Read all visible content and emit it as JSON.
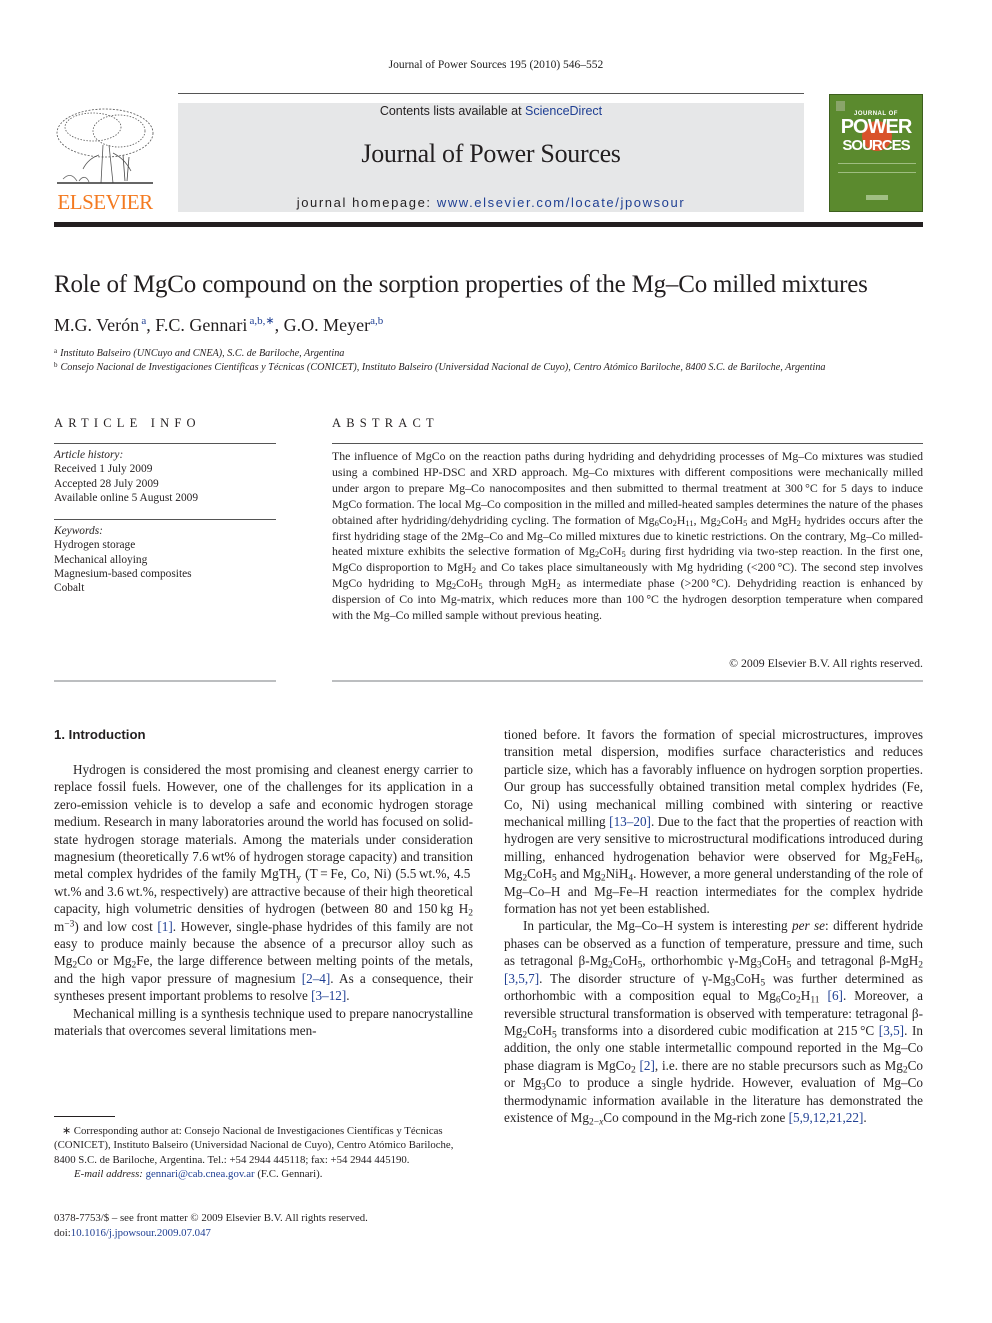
{
  "running_head": "Journal of Power Sources 195 (2010) 546–552",
  "banner": {
    "contents_prefix": "Contents lists available at ",
    "contents_link": "ScienceDirect",
    "journal_title": "Journal of Power Sources",
    "homepage_prefix": "journal homepage: ",
    "homepage_link": "www.elsevier.com/locate/jpowsour"
  },
  "publisher_logo": {
    "word": "ELSEVIER",
    "color": "#f47a20"
  },
  "cover": {
    "top_text": "JOURNAL OF",
    "line1": "POWER",
    "line2": "SOURCES",
    "color": "#5b8a2e"
  },
  "article": {
    "title": "Role of MgCo compound on the sorption properties of the Mg–Co milled mixtures",
    "authors": [
      {
        "name": "M.G. Verón",
        "marks": "a",
        "sep": ", "
      },
      {
        "name": "F.C. Gennari",
        "marks": "a,b,∗",
        "sep": ", "
      },
      {
        "name": "G.O. Meyer",
        "marks": "a,b",
        "sep": ""
      }
    ],
    "affiliations": [
      {
        "mark": "a",
        "text": "Instituto Balseiro (UNCuyo and CNEA), S.C. de Bariloche, Argentina"
      },
      {
        "mark": "b",
        "text": "Consejo Nacional de Investigaciones Científicas y Técnicas (CONICET), Instituto Balseiro (Universidad Nacional de Cuyo), Centro Atómico Bariloche, 8400 S.C. de Bariloche, Argentina"
      }
    ]
  },
  "article_info": {
    "heading": "ARTICLE INFO",
    "history_label": "Article history:",
    "history": [
      "Received 1 July 2009",
      "Accepted 28 July 2009",
      "Available online 5 August 2009"
    ],
    "keywords_label": "Keywords:",
    "keywords": [
      "Hydrogen storage",
      "Mechanical alloying",
      "Magnesium-based composites",
      "Cobalt"
    ]
  },
  "abstract": {
    "heading": "ABSTRACT",
    "copyright": "© 2009 Elsevier B.V. All rights reserved."
  },
  "intro": {
    "heading": "1.  Introduction"
  },
  "footnote": {
    "corresponding": "∗  Corresponding author at: Consejo Nacional de Investigaciones Científicas y Técnicas (CONICET), Instituto Balseiro (Universidad Nacional de Cuyo), Centro Atómico Bariloche, 8400 S.C. de Bariloche, Argentina. Tel.: +54 2944 445118; fax: +54 2944 445190.",
    "email_label": "E-mail address:",
    "email": "gennari@cab.cnea.gov.ar",
    "email_suffix": " (F.C. Gennari)."
  },
  "front_matter": {
    "issn_line": "0378-7753/$ – see front matter © 2009 Elsevier B.V. All rights reserved.",
    "doi_prefix": "doi:",
    "doi": "10.1016/j.jpowsour.2009.07.047"
  },
  "link_color": "#1f3f93"
}
